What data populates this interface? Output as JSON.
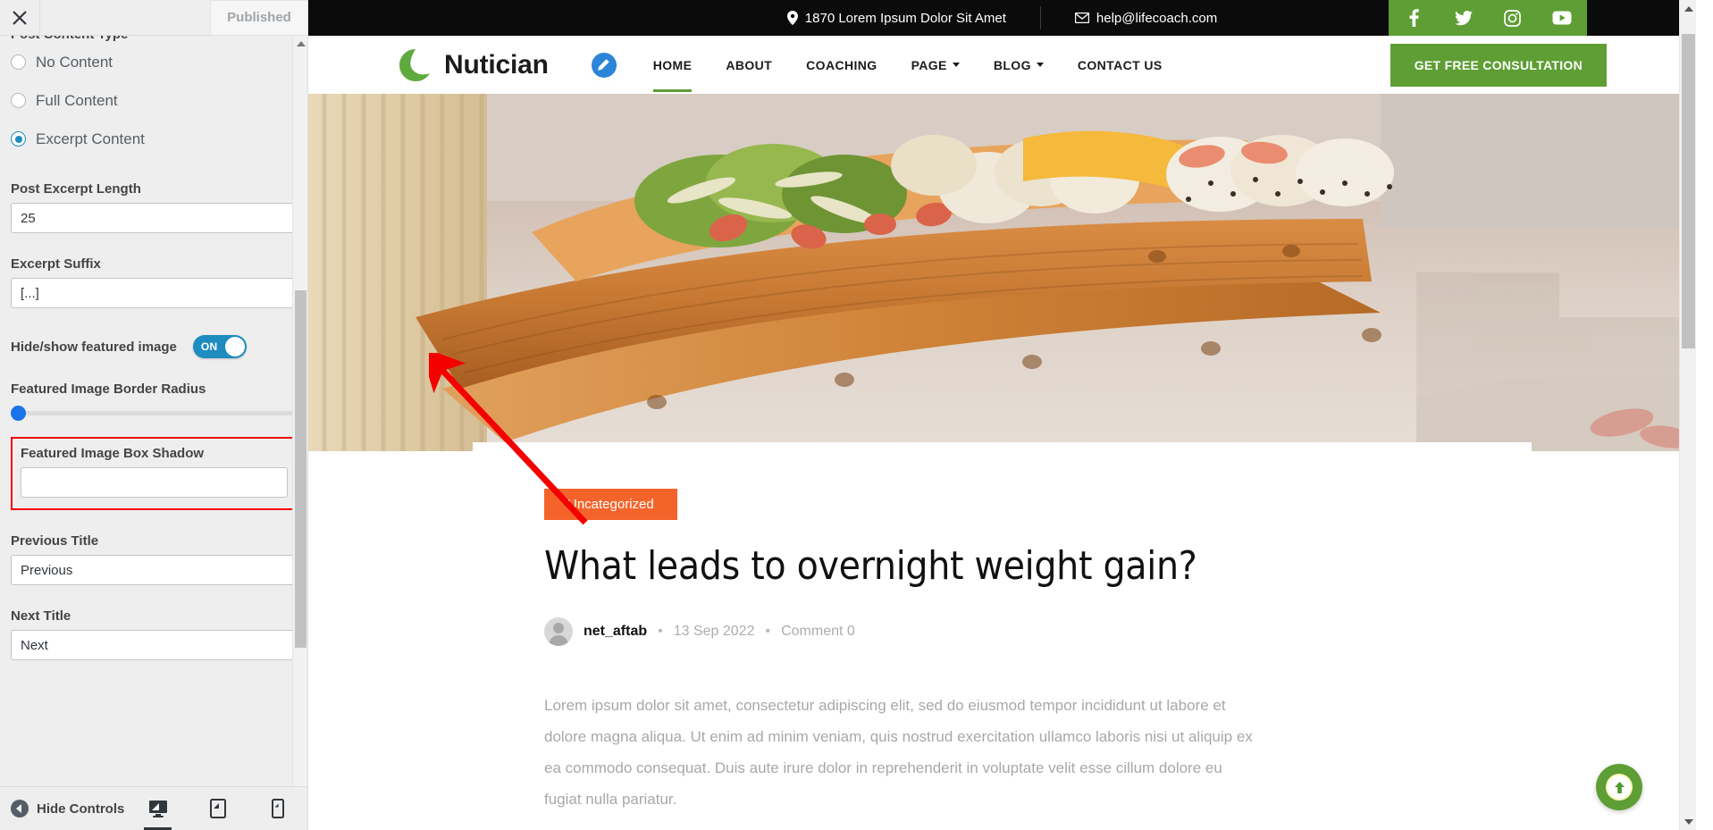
{
  "customizer": {
    "close_icon": "close-icon",
    "published_label": "Published",
    "clipped_heading": "Post Content Type",
    "radios": [
      {
        "label": "No Content",
        "checked": false
      },
      {
        "label": "Full Content",
        "checked": false
      },
      {
        "label": "Excerpt Content",
        "checked": true
      }
    ],
    "excerpt_length": {
      "label": "Post Excerpt Length",
      "value": "25"
    },
    "excerpt_suffix": {
      "label": "Excerpt Suffix",
      "value": "[...]"
    },
    "featured_toggle": {
      "label": "Hide/show featured image",
      "state": "ON"
    },
    "border_radius": {
      "label": "Featured Image Border Radius",
      "value": 0
    },
    "box_shadow": {
      "label": "Featured Image Box Shadow",
      "value": "",
      "highlighted": true,
      "highlight_color": "#f40000"
    },
    "previous_title": {
      "label": "Previous Title",
      "value": "Previous"
    },
    "next_title": {
      "label": "Next Title",
      "value": "Next"
    },
    "footer": {
      "hide_controls_label": "Hide Controls",
      "devices": [
        {
          "name": "desktop-preview-button",
          "icon": "desktop-icon",
          "active": true
        },
        {
          "name": "tablet-preview-button",
          "icon": "tablet-icon",
          "active": false
        },
        {
          "name": "mobile-preview-button",
          "icon": "mobile-icon",
          "active": false
        }
      ]
    }
  },
  "site": {
    "topbar": {
      "address": "1870 Lorem Ipsum Dolor Sit Amet",
      "address_icon": "map-pin-icon",
      "email": "help@lifecoach.com",
      "email_icon": "envelope-icon",
      "social": [
        {
          "name": "facebook-icon",
          "glyph": "f"
        },
        {
          "name": "twitter-icon",
          "glyph": "t"
        },
        {
          "name": "instagram-icon",
          "glyph": "i"
        },
        {
          "name": "youtube-icon",
          "glyph": "y"
        }
      ],
      "social_bg": "#5e9e34",
      "bg": "#0b0b0b"
    },
    "nav": {
      "logo_icon": "nutician-leaf-logo",
      "brand": "Nutician",
      "edit_icon": "pencil-edit-icon",
      "links": [
        {
          "label": "HOME",
          "active": true,
          "dropdown": false
        },
        {
          "label": "ABOUT",
          "active": false,
          "dropdown": false
        },
        {
          "label": "COACHING",
          "active": false,
          "dropdown": false
        },
        {
          "label": "PAGE",
          "active": false,
          "dropdown": true
        },
        {
          "label": "BLOG",
          "active": false,
          "dropdown": true
        },
        {
          "label": "CONTACT US",
          "active": false,
          "dropdown": false
        }
      ],
      "cta": "GET FREE CONSULTATION",
      "cta_color": "#5e9e34"
    },
    "post": {
      "category": "Uncategorized",
      "category_color": "#f4642a",
      "title": "What leads to overnight weight gain?",
      "author": "net_aftab",
      "date": "13 Sep 2022",
      "comments": "Comment 0",
      "separator": "•",
      "body": "Lorem ipsum dolor sit amet, consectetur adipiscing elit, sed do eiusmod tempor incididunt ut labore et dolore magna aliqua. Ut enim ad minim veniam, quis nostrud exercitation ullamco laboris nisi ut aliquip ex ea commodo consequat. Duis aute irure dolor in reprehenderit in voluptate velit esse cillum dolore eu fugiat nulla pariatur."
    },
    "to_top": {
      "icon": "arrow-up-icon",
      "color": "#5e9e34"
    }
  }
}
